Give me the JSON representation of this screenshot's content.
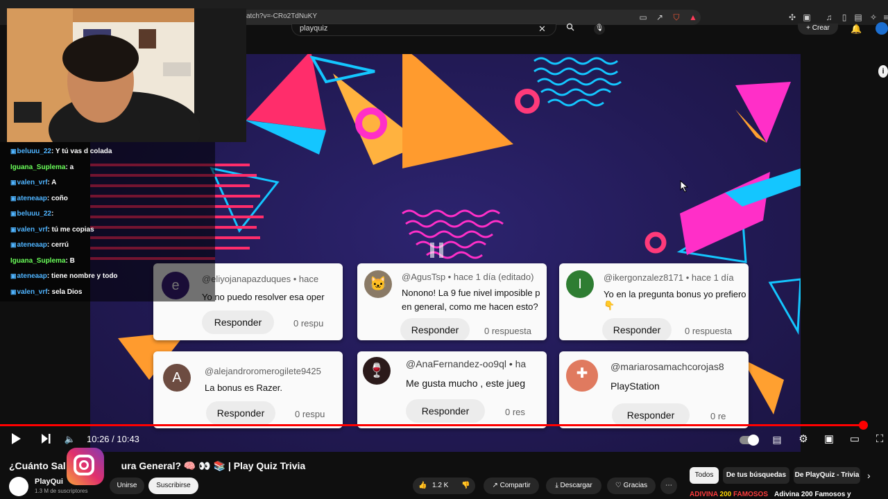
{
  "browser": {
    "url": "atch?v=-CRo2TdNuKY"
  },
  "header": {
    "search_value": "playquiz",
    "create_label": "Crear"
  },
  "chat": [
    {
      "user": "beluuu_22",
      "msg": ": Y tú vas d colada",
      "green": false
    },
    {
      "user": "Iguana_Suplema",
      "msg": ": a",
      "green": true
    },
    {
      "user": "valen_vrf",
      "msg": ": A",
      "green": false
    },
    {
      "user": "ateneaap",
      "msg": ": coño",
      "green": false
    },
    {
      "user": "beluuu_22",
      "msg": ":",
      "green": false
    },
    {
      "user": "valen_vrf",
      "msg": ": tú me copias",
      "green": false
    },
    {
      "user": "ateneaap",
      "msg": ": cerrú",
      "green": false
    },
    {
      "user": "Iguana_Suplema",
      "msg": ": B",
      "green": true
    },
    {
      "user": "ateneaap",
      "msg": ": tiene nombre y todo",
      "green": false
    },
    {
      "user": "valen_vrf",
      "msg": ": sela Dios",
      "green": false
    }
  ],
  "comments": [
    {
      "avatar": "e",
      "handle": "@eliyojanapazduques • hace",
      "text": "Yo no puedo resolver esa oper",
      "reply": "Responder",
      "count": "0 respu",
      "avatar_color": "#3a1d7a"
    },
    {
      "avatar": "",
      "handle": "@AgusTsp • hace 1 día (editado)",
      "text": "Nonono! La 9 fue nivel imposible p",
      "text2": "en general, como me hacen esto?",
      "reply": "Responder",
      "count": "0 respuesta",
      "avatar_color": "#8a7a66"
    },
    {
      "avatar": "I",
      "handle": "@ikergonzalez8171 • hace 1 día",
      "text": "Yo en la pregunta bonus yo prefiero",
      "text2": "👇",
      "reply": "Responder",
      "count": "0 respuesta",
      "avatar_color": "#2e7d32"
    },
    {
      "avatar": "A",
      "handle": "@alejandroromerogilete9425",
      "text": "La bonus es Razer.",
      "reply": "Responder",
      "count": "0 respu",
      "avatar_color": "#6d4c41"
    },
    {
      "avatar": "",
      "handle": "@AnaFernandez-oo9ql • ha",
      "text": "Me gusta mucho , este jueg",
      "reply": "Responder",
      "count": "0 res",
      "avatar_color": "#2b1a1a"
    },
    {
      "avatar": "",
      "handle": "@mariarosamachcorojas8",
      "text": "PlayStation",
      "reply": "Responder",
      "count": "0 re",
      "avatar_color": "#e07a5f"
    }
  ],
  "player": {
    "time": "10:26 / 10:43",
    "progress": 0.973
  },
  "video": {
    "title": "¿Cuánto Sal",
    "title_rest": "ura General? 🧠 👀 📚 | Play Quiz Trivia",
    "channel": "PlayQui",
    "subscribers": "1.3 M de suscriptores",
    "join_label": "Unirse",
    "subscribe_label": "Suscribirse",
    "likes": "1.2 K",
    "share_label": "Compartir",
    "download_label": "Descargar",
    "thanks_label": "Gracias",
    "more_label": "⋯"
  },
  "chips": {
    "all": "Todos",
    "searches": "De tus búsquedas",
    "playquiz": "De PlayQuiz - Trivia"
  },
  "next_video": {
    "badge_prefix": "ADIVINA",
    "badge_number": "200",
    "badge_suffix": "FAMOSOS",
    "title": "Adivina 200 Famosos y"
  },
  "colors": {
    "accent_red": "#ff0000",
    "video_bg": "#221a55",
    "link_blue": "#4fb4ff",
    "chat_green": "#6bff5a"
  }
}
